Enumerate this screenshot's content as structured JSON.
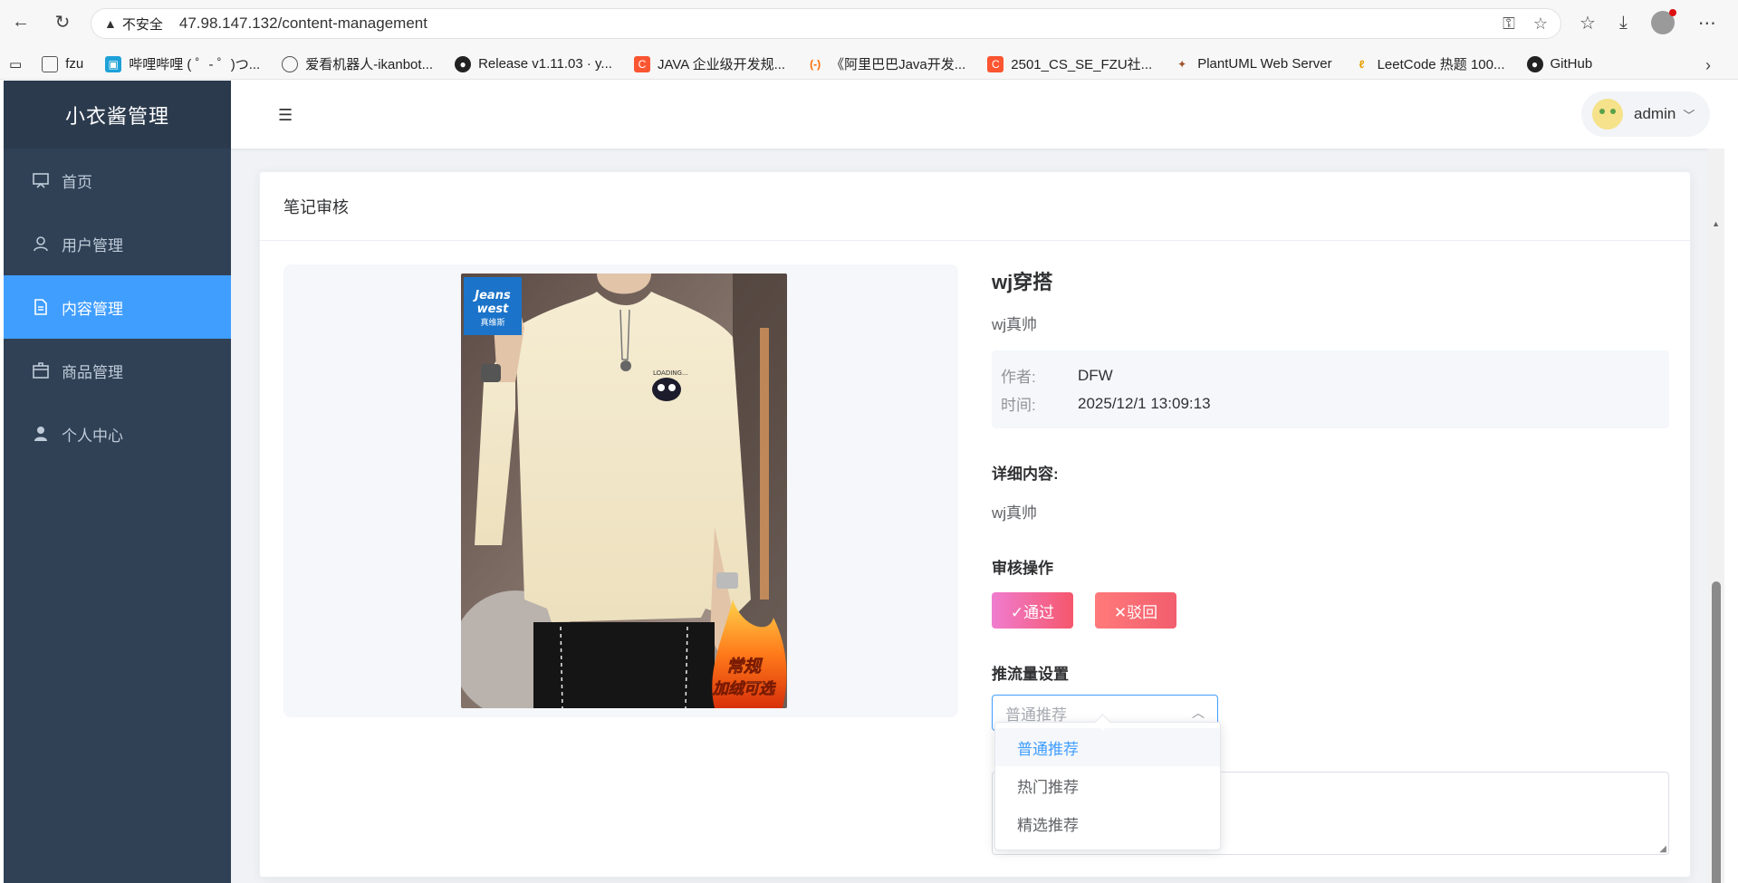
{
  "browser": {
    "insecure_label": "不安全",
    "url": "47.98.147.132/content-management",
    "bookmarks": [
      {
        "label": "fzu",
        "icon": "folder-icon"
      },
      {
        "label": "哔哩哔哩 ( ゜- ゜)つ...",
        "icon": "bilibili-icon"
      },
      {
        "label": "爱看机器人-ikanbot...",
        "icon": "globe-icon"
      },
      {
        "label": "Release v1.11.03 · y...",
        "icon": "github-icon"
      },
      {
        "label": "JAVA 企业级开发规...",
        "icon": "csdn-icon"
      },
      {
        "label": "《阿里巴巴Java开发...",
        "icon": "aliyun-icon"
      },
      {
        "label": "2501_CS_SE_FZU社...",
        "icon": "csdn-icon"
      },
      {
        "label": "PlantUML Web Server",
        "icon": "plantuml-icon"
      },
      {
        "label": "LeetCode 热题 100...",
        "icon": "leetcode-icon"
      },
      {
        "label": "GitHub",
        "icon": "github-icon"
      }
    ]
  },
  "app": {
    "logo": "小衣酱管理",
    "menu": [
      {
        "label": "首页",
        "icon": "monitor-icon"
      },
      {
        "label": "用户管理",
        "icon": "user-icon"
      },
      {
        "label": "内容管理",
        "icon": "document-icon"
      },
      {
        "label": "商品管理",
        "icon": "box-icon"
      },
      {
        "label": "个人中心",
        "icon": "person-icon"
      }
    ],
    "username": "admin"
  },
  "card": {
    "title": "笔记审核",
    "note": {
      "title": "wj穿搭",
      "subtitle": "wj真帅",
      "author_label": "作者:",
      "author": "DFW",
      "time_label": "时间:",
      "time": "2025/12/1 13:09:13",
      "detail_label": "详细内容:",
      "detail": "wj真帅"
    },
    "audit_label": "审核操作",
    "pass_label": "✓通过",
    "reject_label": "✕驳回",
    "traffic_label": "推流量设置",
    "select_placeholder": "普通推荐",
    "options": [
      "普通推荐",
      "热门推荐",
      "精选推荐"
    ],
    "photo_badge": {
      "brand_line1": "Jeans",
      "brand_line2": "west",
      "brand_cn": "真维斯",
      "tag_line1": "常规",
      "tag_line2": "加绒可选"
    }
  }
}
